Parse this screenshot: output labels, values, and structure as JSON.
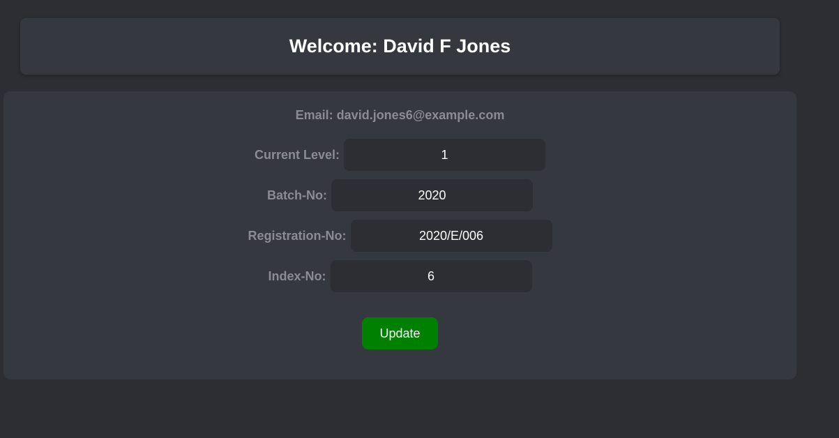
{
  "header": {
    "welcome_text": "Welcome: David F Jones"
  },
  "profile": {
    "email_text": "Email: david.jones6@example.com",
    "fields": [
      {
        "label": "Current Level:",
        "value": "1"
      },
      {
        "label": "Batch-No:",
        "value": "2020"
      },
      {
        "label": "Registration-No:",
        "value": "2020/E/006"
      },
      {
        "label": "Index-No:",
        "value": "6"
      }
    ],
    "update_label": "Update"
  },
  "colors": {
    "background": "#2c2e33",
    "card": "#363840",
    "label": "#8a8c91",
    "button": "#008000"
  }
}
